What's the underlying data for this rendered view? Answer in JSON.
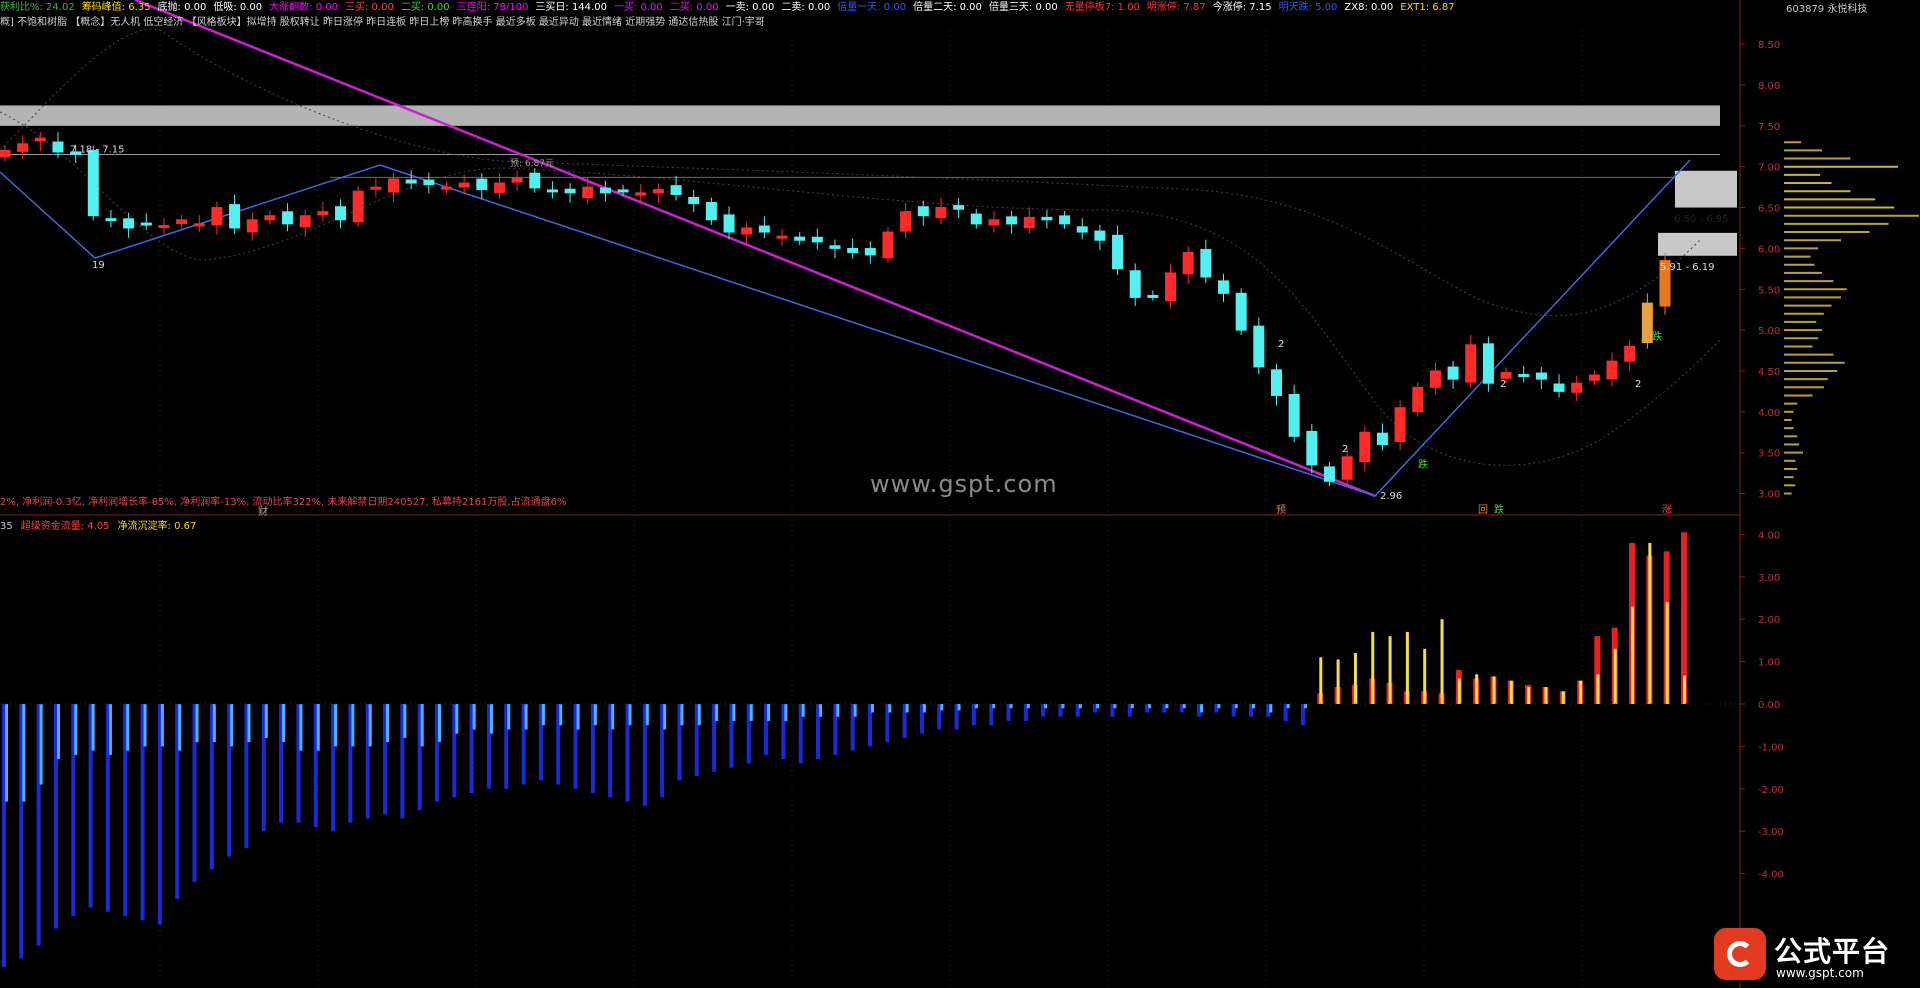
{
  "header": {
    "items": [
      {
        "text": "获利比%: 24.02",
        "color": "#3fb63f"
      },
      {
        "text": "筹码峰值: 6.35",
        "color": "#ffd700"
      },
      {
        "text": "底抛: 0.00",
        "color": "#ffffff"
      },
      {
        "text": "低吸: 0.00",
        "color": "#ffffff"
      },
      {
        "text": "大涨翻数: 0.00",
        "color": "#ff00ff"
      },
      {
        "text": "三买: 0.00",
        "color": "#ff4040"
      },
      {
        "text": "二买: 0.00",
        "color": "#3fd13f"
      },
      {
        "text": "三连阳: 78/100",
        "color": "#ff00ff"
      },
      {
        "text": "三买日: 144.00",
        "color": "#ffffff"
      },
      {
        "text": "一买: 0.00",
        "color": "#ff00ff"
      },
      {
        "text": "二买: 0.00",
        "color": "#ff00ff"
      },
      {
        "text": "一卖: 0.00",
        "color": "#ffffff"
      },
      {
        "text": "二卖: 0.00",
        "color": "#ffffff"
      },
      {
        "text": "倍量一天: 0.00",
        "color": "#2a58ff"
      },
      {
        "text": "倍量二天: 0.00",
        "color": "#ffffff"
      },
      {
        "text": "倍量三天: 0.00",
        "color": "#ffffff"
      },
      {
        "text": "无量停板7: 1.00",
        "color": "#ff3030"
      },
      {
        "text": "明涨停: 7.87",
        "color": "#ff3030"
      },
      {
        "text": "今涨停: 7.15",
        "color": "#ffffff"
      },
      {
        "text": "明天跌: 5.00",
        "color": "#2a58ff"
      },
      {
        "text": "ZX8: 0.00",
        "color": "#ffffff"
      },
      {
        "text": "EXT1: 6.87",
        "color": "#ffd700"
      }
    ]
  },
  "subheader": {
    "items": [
      "概] 不饱和树脂 【概念】无人机 低空经济 【风格板块】拟增持 股权转让 昨日涨停 昨日连板 昨日上榜 昨高换手 最近多板 最近异动 最近情绪 近期强势 通达信热股 江门·宇哥"
    ]
  },
  "stock_label": "603879 永悦科技",
  "finance_line": "2%, 净利润-0.3亿, 净利润增长率-85%, 净利润率-13%, 流动比率322%, 未来解禁日期240527, 私募持2161万股,占流通盘6%",
  "indicator2": {
    "items": [
      {
        "text": "35",
        "color": "#cccccc"
      },
      {
        "text": "超级资金流量: 4.05",
        "color": "#ff4040"
      },
      {
        "text": "净流沉淀率: 0.67",
        "color": "#ffd700"
      }
    ]
  },
  "watermark": "www.gspt.com",
  "logo": {
    "title": "公式平台",
    "url": "www.gspt.com"
  },
  "chart_data": [
    {
      "type": "candlestick",
      "title": "",
      "ylim": [
        2.8,
        8.8
      ],
      "ytick_labels": [
        "8.50",
        "8.00",
        "7.50",
        "7.00",
        "6.50",
        "6.00",
        "5.50",
        "5.00",
        "4.50",
        "4.00",
        "3.50",
        "3.00"
      ],
      "ytick_values": [
        8.5,
        8.0,
        7.5,
        7.0,
        6.5,
        6.0,
        5.5,
        5.0,
        4.5,
        4.0,
        3.5,
        3.0
      ],
      "closes": [
        7.2,
        7.28,
        7.35,
        7.18,
        7.15,
        6.4,
        6.35,
        6.25,
        6.3,
        6.28,
        6.35,
        6.3,
        6.5,
        6.25,
        6.35,
        6.4,
        6.3,
        6.4,
        6.45,
        6.35,
        6.7,
        6.75,
        6.85,
        6.8,
        6.78,
        6.75,
        6.8,
        6.72,
        6.8,
        6.86,
        6.74,
        6.7,
        6.68,
        6.75,
        6.68,
        6.7,
        6.68,
        6.72,
        6.66,
        6.55,
        6.35,
        6.2,
        6.25,
        6.2,
        6.15,
        6.1,
        6.08,
        6.0,
        5.95,
        5.92,
        6.2,
        6.45,
        6.4,
        6.5,
        6.48,
        6.3,
        6.35,
        6.3,
        6.38,
        6.35,
        6.3,
        6.2,
        6.1,
        5.75,
        5.4,
        5.42,
        5.7,
        5.95,
        5.65,
        5.45,
        5.0,
        4.55,
        4.2,
        3.7,
        3.35,
        3.15,
        3.45,
        3.75,
        3.6,
        4.05,
        4.3,
        4.5,
        4.4,
        4.82,
        4.35,
        4.48,
        4.45,
        4.4,
        4.25,
        4.35,
        4.45,
        4.62,
        4.8,
        5.33,
        5.85
      ],
      "xlabel": "",
      "ylabel": "",
      "annotations": [
        "7.18 - 7.15",
        "19",
        "2",
        "2",
        "2",
        "2",
        "2.96",
        "6.50 - 6.95",
        "5.91 - 6.19",
        "预: 6.87元",
        "财",
        "预",
        "回",
        "跌",
        "涨",
        "跌",
        "跌"
      ]
    },
    {
      "type": "bar",
      "title": "",
      "ylim": [
        -6.5,
        4.3
      ],
      "ytick_labels": [
        "4.00",
        "3.00",
        "2.00",
        "1.00",
        "0.00",
        "-1.00",
        "-2.00",
        "-3.00",
        "-4.00"
      ],
      "ytick_values": [
        4,
        3,
        2,
        1,
        0,
        -1,
        -2,
        -3,
        -4
      ],
      "series": [
        {
          "name": "超级资金流量",
          "values": [
            -6.2,
            -6.0,
            -5.7,
            -5.3,
            -5.0,
            -4.8,
            -4.9,
            -5.0,
            -5.1,
            -5.2,
            -4.6,
            -4.2,
            -3.9,
            -3.6,
            -3.4,
            -3.0,
            -2.8,
            -2.8,
            -2.9,
            -3.0,
            -2.8,
            -2.7,
            -2.6,
            -2.7,
            -2.5,
            -2.3,
            -2.2,
            -2.1,
            -2.0,
            -2.0,
            -1.9,
            -1.8,
            -1.9,
            -2.0,
            -2.1,
            -2.2,
            -2.3,
            -2.4,
            -2.2,
            -1.8,
            -1.7,
            -1.6,
            -1.5,
            -1.4,
            -1.2,
            -1.3,
            -1.4,
            -1.3,
            -1.2,
            -1.1,
            -1.0,
            -0.9,
            -0.8,
            -0.7,
            -0.6,
            -0.6,
            -0.5,
            -0.5,
            -0.4,
            -0.4,
            -0.3,
            -0.3,
            -0.3,
            -0.2,
            -0.3,
            -0.3,
            -0.2,
            -0.2,
            -0.2,
            -0.3,
            -0.2,
            -0.3,
            -0.3,
            -0.3,
            -0.4,
            -0.5,
            0.25,
            0.4,
            0.45,
            0.6,
            0.5,
            0.3,
            0.3,
            0.25,
            0.8,
            0.6,
            0.65,
            0.55,
            0.45,
            0.4,
            0.3,
            0.55,
            1.6,
            1.8,
            3.8,
            3.5,
            3.6,
            4.05
          ]
        },
        {
          "name": "净流沉淀率",
          "values": [
            -2.3,
            -2.3,
            -1.9,
            -1.3,
            -1.2,
            -1.1,
            -1.2,
            -1.1,
            -1.0,
            -1.0,
            -1.1,
            -0.9,
            -0.9,
            -1.0,
            -0.9,
            -0.8,
            -0.9,
            -1.1,
            -1.1,
            -1.0,
            -1.0,
            -1.0,
            -0.9,
            -0.8,
            -1.0,
            -0.9,
            -0.7,
            -0.6,
            -0.7,
            -0.6,
            -0.6,
            -0.5,
            -0.5,
            -0.6,
            -0.5,
            -0.6,
            -0.5,
            -0.5,
            -0.6,
            -0.5,
            -0.5,
            -0.4,
            -0.4,
            -0.4,
            -0.4,
            -0.4,
            -0.3,
            -0.3,
            -0.3,
            -0.3,
            -0.2,
            -0.2,
            -0.2,
            -0.2,
            -0.15,
            -0.15,
            -0.1,
            -0.1,
            -0.1,
            -0.1,
            -0.1,
            -0.1,
            -0.1,
            -0.1,
            -0.1,
            -0.1,
            -0.1,
            -0.1,
            -0.1,
            -0.2,
            -0.1,
            -0.1,
            -0.1,
            -0.2,
            -0.1,
            -0.1,
            1.1,
            1.05,
            1.2,
            1.7,
            1.6,
            1.7,
            1.3,
            2.0,
            0.6,
            0.7,
            0.65,
            0.55,
            0.4,
            0.4,
            0.3,
            0.55,
            0.7,
            1.3,
            2.3,
            3.8,
            2.4,
            0.67
          ]
        }
      ]
    },
    {
      "type": "bar",
      "title": "",
      "note": "volume profile",
      "ylim": [
        2.8,
        8.8
      ],
      "y": [
        3.0,
        3.1,
        3.2,
        3.3,
        3.4,
        3.5,
        3.6,
        3.7,
        3.8,
        3.9,
        4.0,
        4.1,
        4.2,
        4.3,
        4.4,
        4.5,
        4.6,
        4.7,
        4.8,
        4.9,
        5.0,
        5.1,
        5.2,
        5.3,
        5.4,
        5.5,
        5.6,
        5.7,
        5.8,
        5.9,
        6.0,
        6.1,
        6.2,
        6.3,
        6.4,
        6.5,
        6.6,
        6.7,
        6.8,
        6.9,
        7.0,
        7.1,
        7.2,
        7.3
      ],
      "values": [
        8,
        12,
        10,
        14,
        12,
        20,
        16,
        14,
        10,
        8,
        10,
        14,
        30,
        42,
        46,
        56,
        64,
        52,
        30,
        36,
        40,
        34,
        42,
        50,
        60,
        66,
        52,
        40,
        32,
        28,
        36,
        60,
        90,
        110,
        142,
        116,
        96,
        70,
        50,
        38,
        120,
        70,
        40,
        18
      ]
    }
  ]
}
